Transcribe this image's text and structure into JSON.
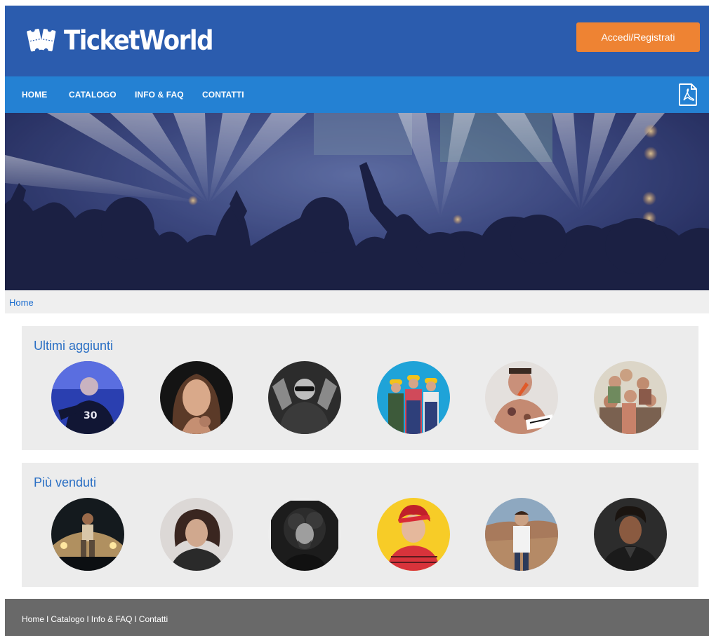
{
  "header": {
    "logo_text": "TicketWorld",
    "login_label": "Accedi/Registrati",
    "brand_color": "#2b5cae",
    "accent_color": "#ee8333"
  },
  "nav": {
    "items": [
      "HOME",
      "CATALOGO",
      "INFO & FAQ",
      "CONTATTI"
    ],
    "pdf_icon": "pdf-icon",
    "color": "#2481d3"
  },
  "breadcrumb": {
    "home": "Home"
  },
  "sections": [
    {
      "title": "Ultimi aggiunti"
    },
    {
      "title": "Più venduti"
    }
  ],
  "footer": {
    "links": [
      "Home",
      "Catalogo",
      "Info & FAQ",
      "Contatti"
    ],
    "separator": "I"
  }
}
